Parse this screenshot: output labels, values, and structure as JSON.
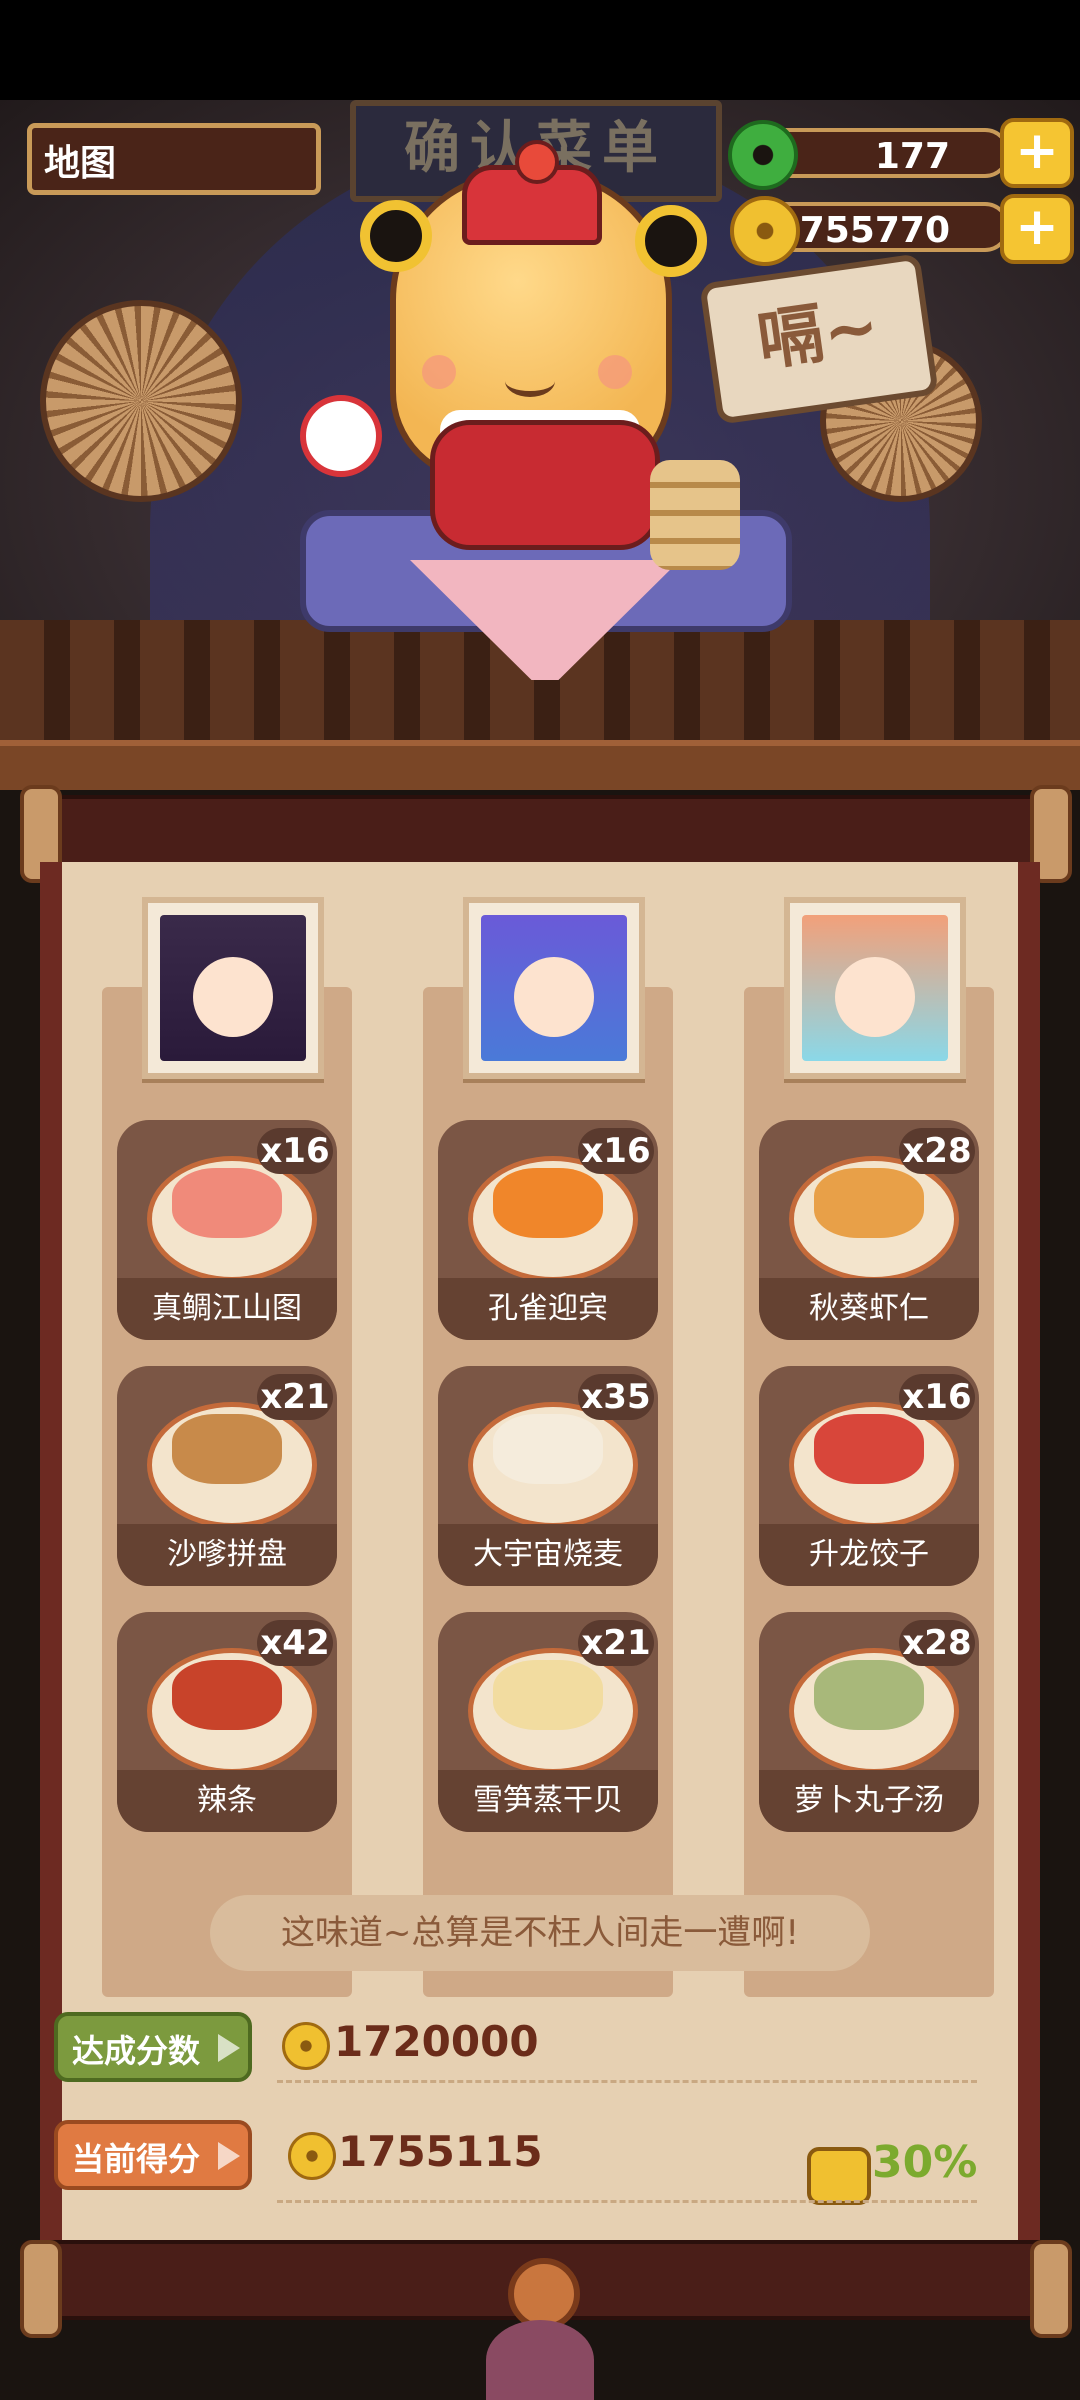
{
  "scene": {
    "sign_text": "确认菜单",
    "speech_text": "嗝~"
  },
  "hud": {
    "map_label": "地图",
    "jade": {
      "value": "177",
      "plus": "+"
    },
    "coins": {
      "value": "755770",
      "plus": "+"
    }
  },
  "menu": {
    "columns": [
      {
        "character": "character-1",
        "dishes": [
          {
            "name": "真鲷江山图",
            "count": "x16"
          },
          {
            "name": "沙嗲拼盘",
            "count": "x21"
          },
          {
            "name": "辣条",
            "count": "x42"
          }
        ]
      },
      {
        "character": "character-2",
        "dishes": [
          {
            "name": "孔雀迎宾",
            "count": "x16"
          },
          {
            "name": "大宇宙烧麦",
            "count": "x35"
          },
          {
            "name": "雪笋蒸干贝",
            "count": "x21"
          }
        ]
      },
      {
        "character": "character-3",
        "dishes": [
          {
            "name": "秋葵虾仁",
            "count": "x28"
          },
          {
            "name": "升龙饺子",
            "count": "x16"
          },
          {
            "name": "萝卜丸子汤",
            "count": "x28"
          }
        ]
      }
    ],
    "quote": "这味道~总算是不枉人间走一遭啊!",
    "target": {
      "label": "达成分数",
      "value": "1720000"
    },
    "current": {
      "label": "当前得分",
      "value": "1755115"
    },
    "bonus": "30%"
  },
  "colors": {
    "board": "#6d2a22",
    "paper": "#e6d0b2",
    "target_tag": "#7c9a3e",
    "current_tag": "#e07a42",
    "bonus": "#7caa2e"
  }
}
